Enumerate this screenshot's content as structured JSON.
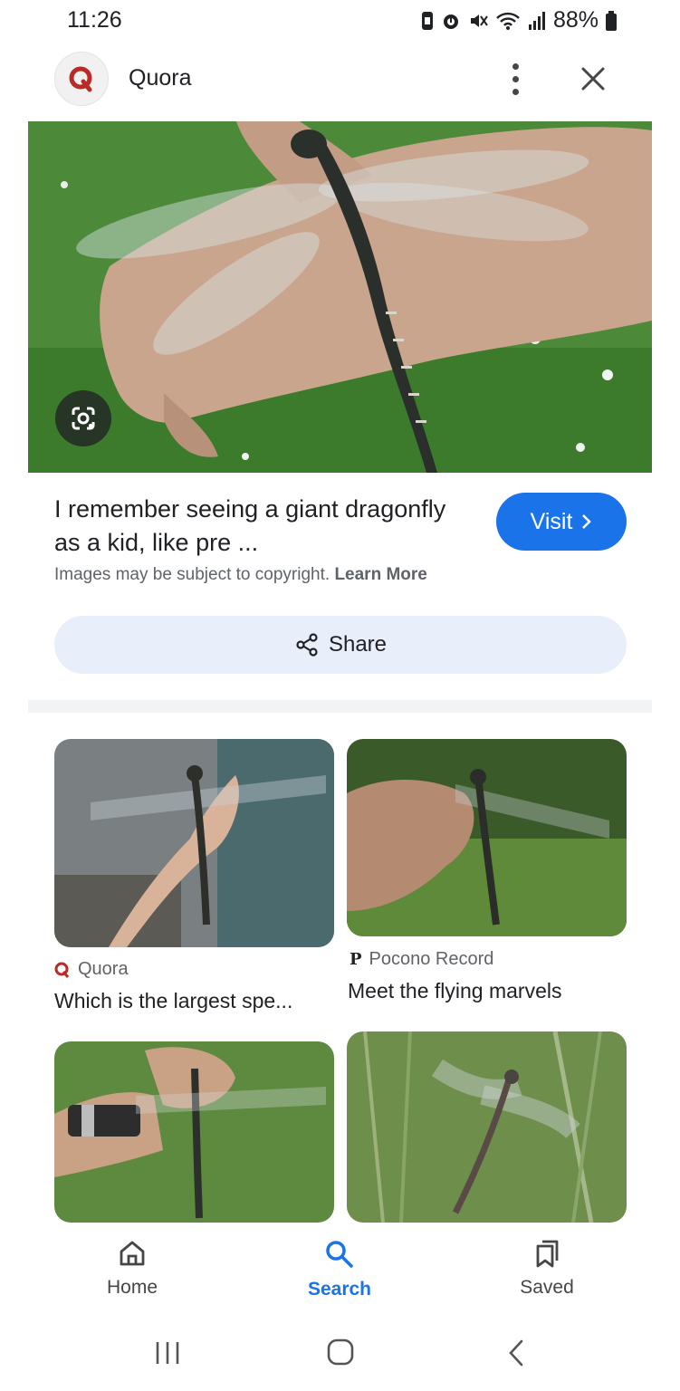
{
  "status_bar": {
    "time": "11:26",
    "battery": "88%"
  },
  "header": {
    "site_name": "Quora",
    "logo_icon": "quora-logo-icon"
  },
  "result": {
    "title": "I remember seeing a giant dragonfly as a kid, like pre ...",
    "visit_label": "Visit",
    "copyright_text": "Images may be subject to copyright.",
    "learn_more": "Learn More",
    "share_label": "Share"
  },
  "related": [
    {
      "source": "Quora",
      "caption": "Which is the largest spe..."
    },
    {
      "source": "Pocono Record",
      "caption": "Meet the flying marvels"
    },
    {
      "source": "",
      "caption": ""
    },
    {
      "source": "",
      "caption": ""
    }
  ],
  "bottom_nav": {
    "home": "Home",
    "search": "Search",
    "saved": "Saved"
  },
  "colors": {
    "accent": "#1a73e8",
    "quora_red": "#b92b27"
  }
}
